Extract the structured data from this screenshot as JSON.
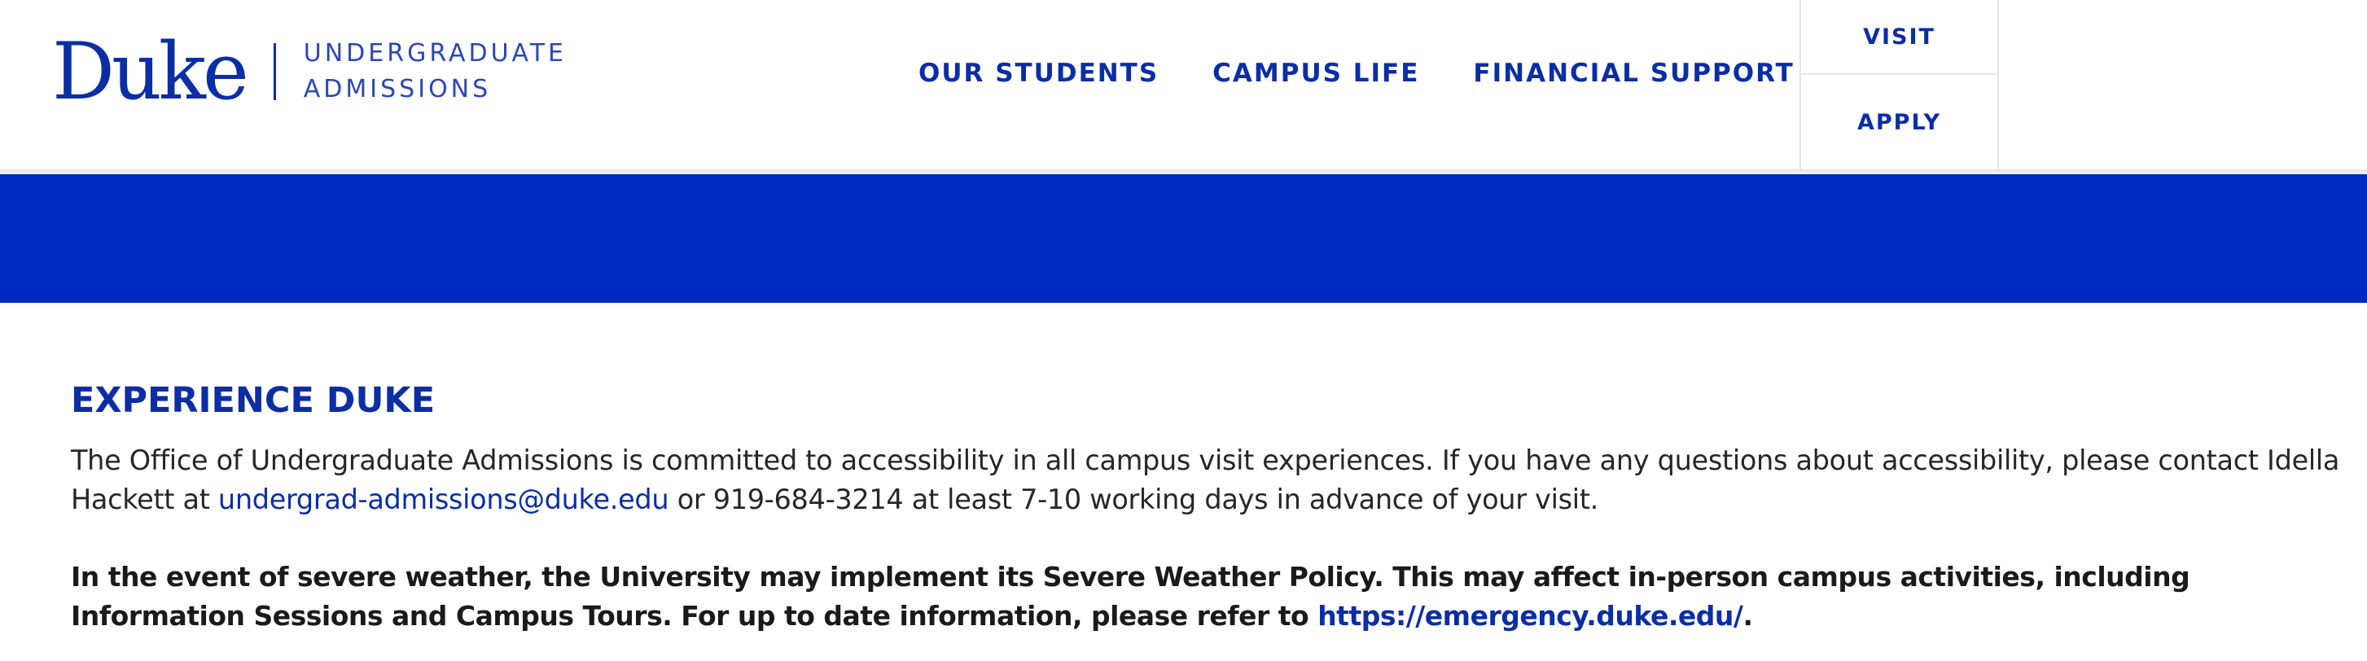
{
  "brand": {
    "wordmark": "Duke",
    "subtitle_line1": "UNDERGRADUATE",
    "subtitle_line2": "ADMISSIONS",
    "color": "#0b2ea5"
  },
  "main_nav": {
    "items": [
      {
        "label": "OUR STUDENTS"
      },
      {
        "label": "CAMPUS LIFE"
      },
      {
        "label": "FINANCIAL SUPPORT"
      }
    ]
  },
  "side_nav": {
    "items": [
      {
        "label": "VISIT"
      },
      {
        "label": "APPLY"
      }
    ]
  },
  "hero": {
    "color": "#0029c1"
  },
  "content": {
    "title": "EXPERIENCE DUKE",
    "para1_before": "The Office of Undergraduate Admissions is committed to accessibility in all campus visit experiences. If you have any questions about accessibility, please contact Idella Hackett at ",
    "para1_email": "undergrad-admissions@duke.edu",
    "para1_after": " or 919-684-3214 at least 7-10 working days in advance of your visit.",
    "para2_before": "In the event of severe weather, the University may implement its Severe Weather Policy. This may affect in-person campus activities, including Information Sessions and Campus Tours. For up to date information, please refer to ",
    "para2_link": "https://emergency.duke.edu/",
    "para2_after": "."
  }
}
